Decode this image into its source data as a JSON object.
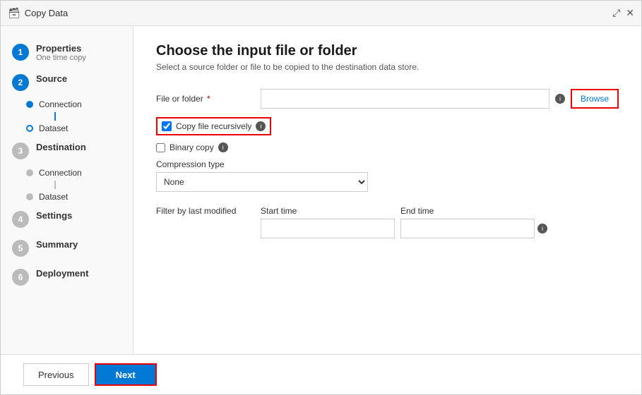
{
  "window": {
    "title": "Copy Data",
    "icon": "🗃"
  },
  "sidebar": {
    "steps": [
      {
        "number": "1",
        "label": "Properties",
        "sub": "One time copy",
        "state": "active",
        "children": []
      },
      {
        "number": "2",
        "label": "Source",
        "state": "active",
        "children": [
          {
            "label": "Connection",
            "dot": "blue"
          },
          {
            "label": "Dataset",
            "dot": "hollow"
          }
        ]
      },
      {
        "number": "3",
        "label": "Destination",
        "state": "inactive",
        "children": [
          {
            "label": "Connection",
            "dot": "gray"
          },
          {
            "label": "Dataset",
            "dot": "gray"
          }
        ]
      },
      {
        "number": "4",
        "label": "Settings",
        "state": "inactive",
        "children": []
      },
      {
        "number": "5",
        "label": "Summary",
        "state": "inactive",
        "children": []
      },
      {
        "number": "6",
        "label": "Deployment",
        "state": "inactive",
        "children": []
      }
    ]
  },
  "main": {
    "title": "Choose the input file or folder",
    "subtitle": "Select a source folder or file to be copied to the destination data store.",
    "form": {
      "file_folder_label": "File or folder",
      "file_folder_placeholder": "",
      "browse_label": "Browse",
      "copy_recursive_label": "Copy file recursively",
      "binary_copy_label": "Binary copy",
      "compression_type_label": "Compression type",
      "compression_options": [
        "None"
      ],
      "compression_selected": "None",
      "filter_label": "Filter by last modified",
      "start_time_label": "Start time",
      "end_time_label": "End time",
      "start_time_placeholder": "",
      "end_time_placeholder": ""
    }
  },
  "footer": {
    "previous_label": "Previous",
    "next_label": "Next"
  }
}
